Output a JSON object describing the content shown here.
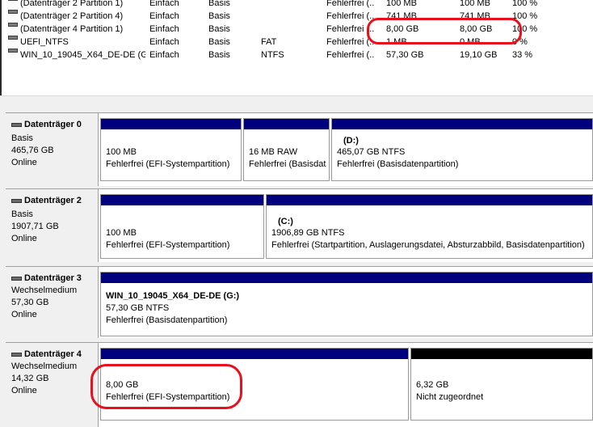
{
  "volumes": [
    {
      "name": "(Datenträger 2 Partition 1)",
      "layout": "Einfach",
      "type": "Basis",
      "fs": "",
      "status": "Fehlerfrei (...",
      "capacity": "100 MB",
      "free": "100 MB",
      "pct": "100 %"
    },
    {
      "name": "(Datenträger 2 Partition 4)",
      "layout": "Einfach",
      "type": "Basis",
      "fs": "",
      "status": "Fehlerfrei (...",
      "capacity": "741 MB",
      "free": "741 MB",
      "pct": "100 %"
    },
    {
      "name": "(Datenträger 4 Partition 1)",
      "layout": "Einfach",
      "type": "Basis",
      "fs": "",
      "status": "Fehlerfrei (...",
      "capacity": "8,00 GB",
      "free": "8,00 GB",
      "pct": "100 %"
    },
    {
      "name": "UEFI_NTFS",
      "layout": "Einfach",
      "type": "Basis",
      "fs": "FAT",
      "status": "Fehlerfrei (...",
      "capacity": "1 MB",
      "free": "0 MB",
      "pct": "0 %"
    },
    {
      "name": "WIN_10_19045_X64_DE-DE (G:)",
      "layout": "Einfach",
      "type": "Basis",
      "fs": "NTFS",
      "status": "Fehlerfrei (...",
      "capacity": "57,30 GB",
      "free": "19,10 GB",
      "pct": "33 %"
    }
  ],
  "disks": [
    {
      "title": "Datenträger 0",
      "kind": "Basis",
      "size": "465,76 GB",
      "state": "Online",
      "partitions": [
        {
          "label": "",
          "size": "100 MB",
          "status": "Fehlerfrei (EFI-Systempartition)"
        },
        {
          "label": "",
          "size": "16 MB RAW",
          "status": "Fehlerfrei (Basisdat"
        },
        {
          "label": "(D:)",
          "size": "465,07 GB NTFS",
          "status": "Fehlerfrei (Basisdatenpartition)"
        }
      ]
    },
    {
      "title": "Datenträger 2",
      "kind": "Basis",
      "size": "1907,71 GB",
      "state": "Online",
      "partitions": [
        {
          "label": "",
          "size": "100 MB",
          "status": "Fehlerfrei (EFI-Systempartition)"
        },
        {
          "label": "(C:)",
          "size": "1906,89 GB NTFS",
          "status": "Fehlerfrei (Startpartition, Auslagerungsdatei, Absturzabbild, Basisdatenpartition)"
        }
      ]
    },
    {
      "title": "Datenträger 3",
      "kind": "Wechselmedium",
      "size": "57,30 GB",
      "state": "Online",
      "partitions": [
        {
          "label": "WIN_10_19045_X64_DE-DE  (G:)",
          "size": "57,30 GB NTFS",
          "status": "Fehlerfrei (Basisdatenpartition)"
        }
      ]
    },
    {
      "title": "Datenträger 4",
      "kind": "Wechselmedium",
      "size": "14,32 GB",
      "state": "Online",
      "partitions": [
        {
          "label": "",
          "size": "8,00 GB",
          "status": "Fehlerfrei (EFI-Systempartition)"
        },
        {
          "label": "",
          "size": "6,32 GB",
          "status": "Nicht zugeordnet"
        }
      ]
    }
  ],
  "colors": {
    "primary_bar": "#00007f",
    "unallocated_bar": "#000000",
    "highlight": "#e8101c"
  }
}
